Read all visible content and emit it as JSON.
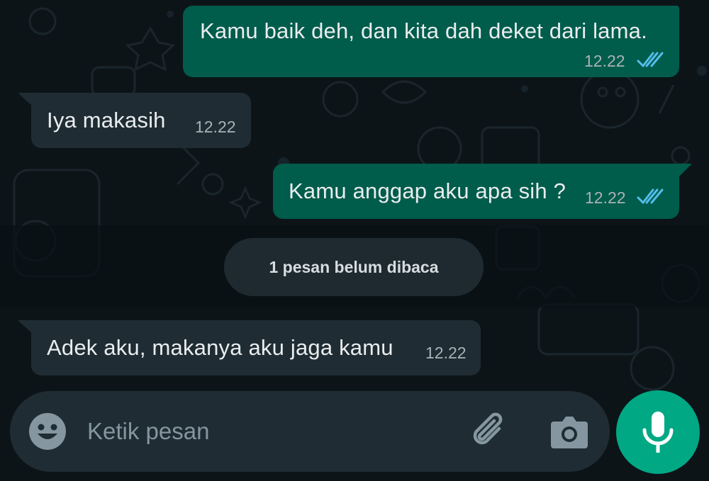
{
  "messages": [
    {
      "direction": "outgoing",
      "text": "Kamu baik deh, dan kita dah deket dari lama.",
      "time": "12.22",
      "status": "read"
    },
    {
      "direction": "incoming",
      "text": "Iya makasih",
      "time": "12.22"
    },
    {
      "direction": "outgoing",
      "text": "Kamu anggap aku apa sih ?",
      "time": "12.22",
      "status": "read"
    },
    {
      "direction": "incoming",
      "text": "Adek aku, makanya aku jaga kamu",
      "time": "12.22"
    }
  ],
  "unread_banner": "1 pesan belum dibaca",
  "composer": {
    "placeholder": "Ketik pesan",
    "emoji_icon": "emoji-icon",
    "attach_icon": "paperclip-icon",
    "camera_icon": "camera-icon",
    "mic_icon": "microphone-icon"
  },
  "colors": {
    "outgoing_bubble": "#005c4b",
    "incoming_bubble": "#1f2c33",
    "read_ticks": "#53bdeb",
    "mic_button": "#00a884",
    "background": "#0b141a"
  }
}
